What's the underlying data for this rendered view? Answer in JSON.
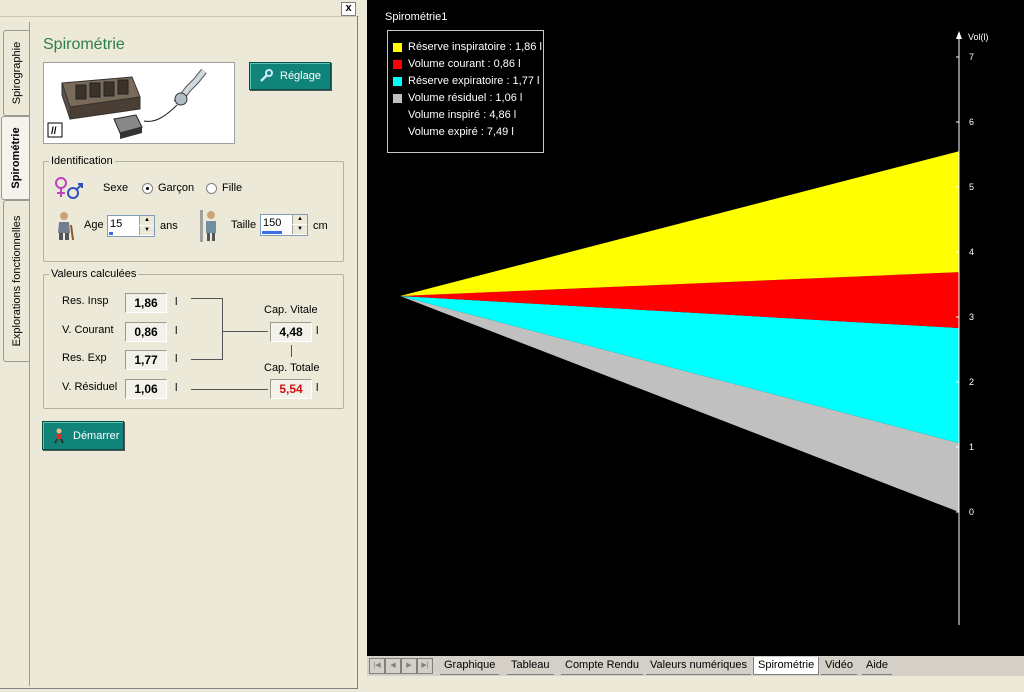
{
  "window": {
    "close_label": "x"
  },
  "side_tabs": [
    {
      "label": "Spirographie"
    },
    {
      "label": "Spirométrie"
    },
    {
      "label": "Explorations fonctionnelles"
    }
  ],
  "panel": {
    "title": "Spirométrie",
    "reglage_label": "Réglage",
    "demarrer_label": "Démarrer"
  },
  "identification": {
    "legend": "Identification",
    "sexe_label": "Sexe",
    "sexe_options": [
      "Garçon",
      "Fille"
    ],
    "sexe_selected": "Garçon",
    "age_label": "Age",
    "age_value": "15",
    "age_unit": "ans",
    "taille_label": "Taille",
    "taille_value": "150",
    "taille_unit": "cm"
  },
  "valeurs": {
    "legend": "Valeurs calculées",
    "rows": [
      {
        "label": "Res. Insp",
        "value": "1,86",
        "unit": "l"
      },
      {
        "label": "V. Courant",
        "value": "0,86",
        "unit": "l"
      },
      {
        "label": "Res. Exp",
        "value": "1,77",
        "unit": "l"
      },
      {
        "label": "V. Résiduel",
        "value": "1,06",
        "unit": "l"
      }
    ],
    "cap_vitale_label": "Cap. Vitale",
    "cap_vitale_value": "4,48",
    "cap_vitale_unit": "l",
    "cap_totale_label": "Cap. Totale",
    "cap_totale_value": "5,54",
    "cap_totale_unit": "l"
  },
  "chart": {
    "title": "Spirométrie1",
    "axis_label": "Vol(l)",
    "ticks": [
      "0",
      "1",
      "2",
      "3",
      "4",
      "5",
      "6",
      "7"
    ],
    "legend": [
      {
        "label": "Réserve inspiratoire : 1,86 l",
        "color": "#ffff00"
      },
      {
        "label": "Volume courant : 0,86 l",
        "color": "#ff0000"
      },
      {
        "label": "Réserve expiratoire : 1,77 l",
        "color": "#00ffff"
      },
      {
        "label": "Volume résiduel : 1,06 l",
        "color": "#c0c0c0"
      },
      {
        "label": "Volume inspiré : 4,86 l",
        "color": ""
      },
      {
        "label": "Volume expiré : 7,49 l",
        "color": ""
      }
    ]
  },
  "chart_data": {
    "type": "area",
    "title": "Spirométrie1",
    "ylabel": "Vol(l)",
    "ylim": [
      0,
      7
    ],
    "series": [
      {
        "name": "Volume résiduel",
        "color": "#c0c0c0",
        "from": 0,
        "to": 1.06
      },
      {
        "name": "Réserve expiratoire",
        "color": "#00ffff",
        "from": 1.06,
        "to": 2.83
      },
      {
        "name": "Volume courant",
        "color": "#ff0000",
        "from": 2.83,
        "to": 3.69
      },
      {
        "name": "Réserve inspiratoire",
        "color": "#ffff00",
        "from": 3.69,
        "to": 5.55
      }
    ]
  },
  "bottom_tabs": [
    {
      "label": "Graphique"
    },
    {
      "label": "Tableau"
    },
    {
      "label": "Compte Rendu"
    },
    {
      "label": "Valeurs numériques"
    },
    {
      "label": "Spirométrie",
      "active": true
    },
    {
      "label": "Vidéo"
    },
    {
      "label": "Aide"
    }
  ]
}
